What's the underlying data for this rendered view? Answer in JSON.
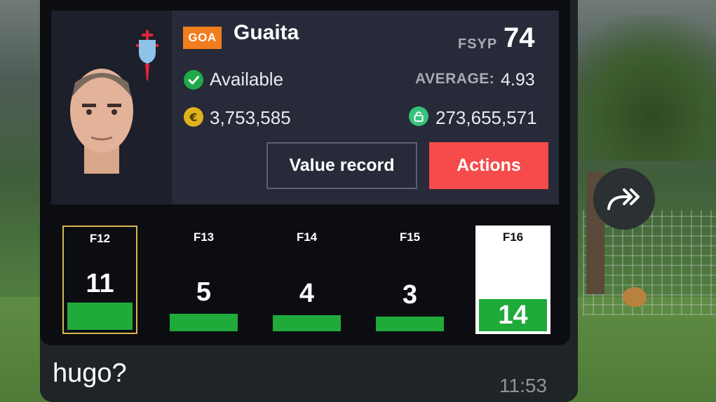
{
  "player": {
    "position": "GOA",
    "name": "Guaita",
    "rating_label": "FSYP",
    "rating_value": "74",
    "status": "Available",
    "average_label": "AVERAGE:",
    "average_value": "4.93",
    "market_value": "3,753,585",
    "clause_value": "273,655,571"
  },
  "buttons": {
    "value_record": "Value record",
    "actions": "Actions"
  },
  "gameweeks": [
    {
      "label": "F12",
      "points": "11",
      "points_value": 11
    },
    {
      "label": "F13",
      "points": "5",
      "points_value": 5
    },
    {
      "label": "F14",
      "points": "4",
      "points_value": 4
    },
    {
      "label": "F15",
      "points": "3",
      "points_value": 3
    },
    {
      "label": "F16",
      "points": "14",
      "points_value": 14
    }
  ],
  "message": {
    "text": "hugo?",
    "time": "11:53"
  },
  "colors": {
    "position_tag": "#f07d1e",
    "actions_button": "#f54b4b",
    "points_bar": "#1faa3a",
    "available": "#1faa4a",
    "coin": "#e1b21b",
    "clause": "#36c27a"
  },
  "icons": {
    "status": "check-circle-icon",
    "market_value": "euro-coin-icon",
    "clause": "lock-icon",
    "forward": "forward-share-icon",
    "club": "club-crest-icon"
  }
}
